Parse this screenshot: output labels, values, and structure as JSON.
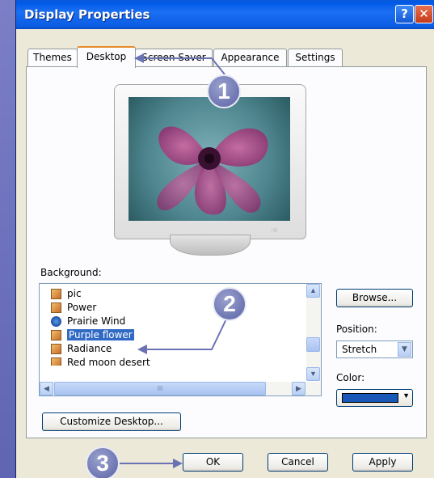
{
  "window": {
    "title": "Display Properties",
    "help_label": "?",
    "close_label": "✕"
  },
  "tabs": [
    {
      "label": "Themes"
    },
    {
      "label": "Desktop"
    },
    {
      "label": "Screen Saver"
    },
    {
      "label": "Appearance"
    },
    {
      "label": "Settings"
    }
  ],
  "active_tab": "Desktop",
  "background": {
    "label": "Background:",
    "items": [
      {
        "label": "pic",
        "icon": "image-file-icon"
      },
      {
        "label": "Power",
        "icon": "image-file-icon"
      },
      {
        "label": "Prairie Wind",
        "icon": "wallpaper-globe-icon"
      },
      {
        "label": "Purple flower",
        "icon": "image-file-icon",
        "selected": true
      },
      {
        "label": "Radiance",
        "icon": "image-file-icon"
      },
      {
        "label": "Red moon desert",
        "icon": "image-file-icon"
      }
    ],
    "hscroll_grip": "III"
  },
  "side": {
    "browse_label": "Browse...",
    "position_label": "Position:",
    "position_value": "Stretch",
    "color_label": "Color:",
    "color_value": "#1a58b8"
  },
  "customize_label": "Customize Desktop...",
  "footer": {
    "ok_label": "OK",
    "cancel_label": "Cancel",
    "apply_label": "Apply"
  },
  "callouts": [
    "1",
    "2",
    "3"
  ],
  "colors": {
    "titlebar": "#0058e6",
    "selection": "#316ac5",
    "callout": "#6d74b6"
  }
}
